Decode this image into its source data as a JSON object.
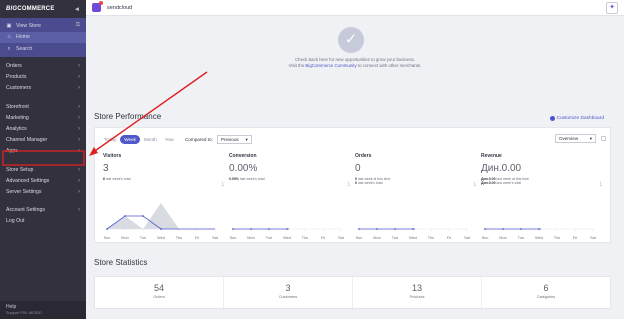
{
  "sidebar": {
    "brand": {
      "big": "BIG",
      "rest": "COMMERCE"
    },
    "top_items": [
      {
        "label": "View Store",
        "icon": "store-icon"
      },
      {
        "label": "Home",
        "icon": "home-icon"
      },
      {
        "label": "Search",
        "icon": "search-icon"
      }
    ],
    "nav": {
      "orders": "Orders",
      "products": "Products",
      "customers": "Customers",
      "storefront": "Storefront",
      "marketing": "Marketing",
      "analytics": "Analytics",
      "channel_manager": "Channel Manager",
      "apps": "Apps",
      "store_setup": "Store Setup",
      "advanced_settings": "Advanced Settings",
      "server_settings": "Server Settings",
      "account_settings": "Account Settings",
      "log_out": "Log Out"
    },
    "help": {
      "label": "Help",
      "sub": "Support PIN: 867530"
    }
  },
  "topbar": {
    "store_name": "sendcloud"
  },
  "hero": {
    "line1": "Check back here for new opportunities to grow your business.",
    "line2_pre": "Visit the ",
    "line2_link": "BigCommerce Community",
    "line2_post": " to connect with other merchants."
  },
  "performance": {
    "title": "Store Performance",
    "customize": "Customize Dashboard",
    "tabs": [
      "Today",
      "Week",
      "Month",
      "Year"
    ],
    "active_tab": "Week",
    "compared_label": "Compared to:",
    "compared_value": "Previous",
    "view_value": "Overview",
    "metrics": [
      {
        "label": "Visitors",
        "value": "3",
        "note_b": "6",
        "note": " last week's total"
      },
      {
        "label": "Conversion",
        "value": "0.00%",
        "note_b": "0.00%",
        "note": " last week's total"
      },
      {
        "label": "Orders",
        "value": "0",
        "note_b": "0",
        "note": " last week at this time",
        "note2_b": "0",
        "note2": " last week's total"
      },
      {
        "label": "Revenue",
        "value": "Дин.0.00",
        "note_b": "Дин.0.00",
        "note": " last week at this time",
        "note2_b": "Дин.0.00",
        "note2": " last week's total"
      }
    ],
    "days": [
      "Sun",
      "Mon",
      "Tue",
      "Wed",
      "Thu",
      "Fri",
      "Sat"
    ]
  },
  "statistics": {
    "title": "Store Statistics",
    "items": [
      {
        "value": "54",
        "label": "Orders"
      },
      {
        "value": "3",
        "label": "Customers"
      },
      {
        "value": "13",
        "label": "Products"
      },
      {
        "value": "6",
        "label": "Categories"
      }
    ]
  },
  "chart_data": {
    "type": "line",
    "categories": [
      "Sun",
      "Mon",
      "Tue",
      "Wed",
      "Thu",
      "Fri",
      "Sat"
    ],
    "series": [
      {
        "values": [
          0,
          1,
          0,
          2,
          0,
          0,
          0
        ]
      },
      {
        "values": [
          0,
          1,
          1,
          0,
          0,
          0,
          0
        ]
      }
    ],
    "colors": {
      "current": "#5059c9",
      "previous_fill": "#d9dbe3"
    }
  },
  "colors": {
    "accent": "#5059c9",
    "sidebar": "#34313f",
    "annotation": "#e02020"
  }
}
